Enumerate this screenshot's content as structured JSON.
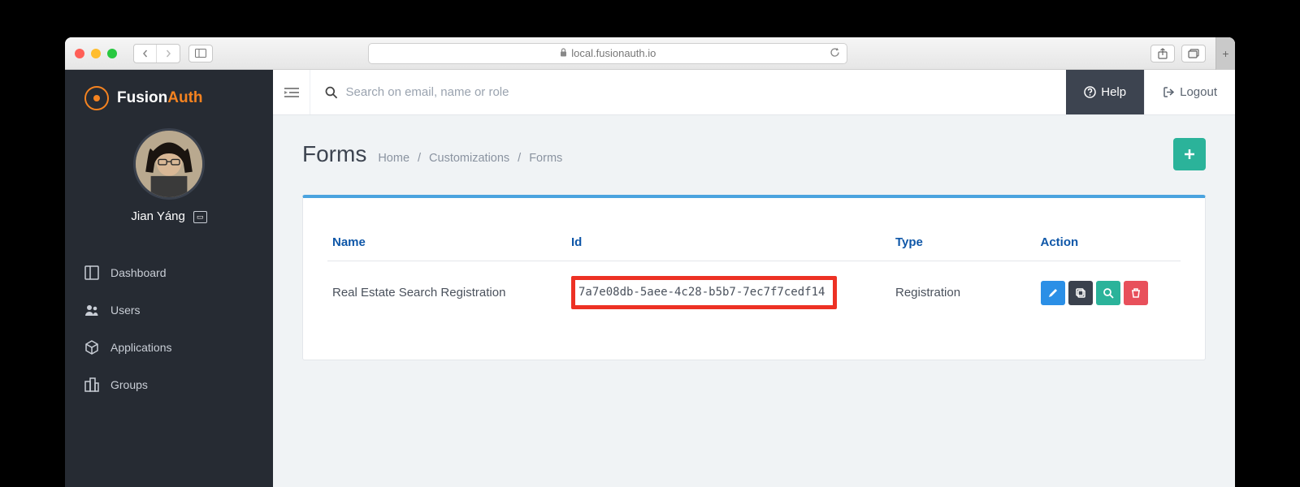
{
  "browser": {
    "address": "local.fusionauth.io"
  },
  "brand": {
    "name_a": "Fusion",
    "name_b": "Auth"
  },
  "user": {
    "name": "Jian Yáng"
  },
  "sidebar": {
    "items": [
      {
        "label": "Dashboard"
      },
      {
        "label": "Users"
      },
      {
        "label": "Applications"
      },
      {
        "label": "Groups"
      }
    ]
  },
  "topbar": {
    "search_placeholder": "Search on email, name or role",
    "help_label": "Help",
    "logout_label": "Logout"
  },
  "page": {
    "title": "Forms",
    "breadcrumbs": [
      "Home",
      "Customizations",
      "Forms"
    ]
  },
  "table": {
    "headers": {
      "name": "Name",
      "id": "Id",
      "type": "Type",
      "action": "Action"
    },
    "rows": [
      {
        "name": "Real Estate Search Registration",
        "id": "7a7e08db-5aee-4c28-b5b7-7ec7f7cedf14",
        "type": "Registration"
      }
    ]
  }
}
